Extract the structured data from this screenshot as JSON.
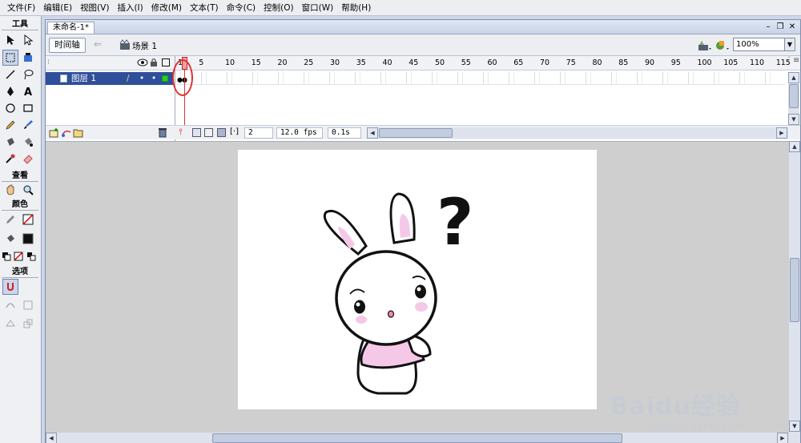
{
  "menu": [
    "文件(F)",
    "编辑(E)",
    "视图(V)",
    "插入(I)",
    "修改(M)",
    "文本(T)",
    "命令(C)",
    "控制(O)",
    "窗口(W)",
    "帮助(H)"
  ],
  "toolbox": {
    "sections": {
      "tools": "工具",
      "view": "查看",
      "colors": "颜色",
      "options": "选项"
    }
  },
  "document": {
    "tab_title": "未命名-1*",
    "timeline_button": "时间轴",
    "scene_label": "场景 1",
    "zoom": "100%"
  },
  "timeline": {
    "layer_name": "图层 1",
    "frame_numbers": [
      "1",
      "5",
      "10",
      "15",
      "20",
      "25",
      "30",
      "35",
      "40",
      "45",
      "50",
      "55",
      "60",
      "65",
      "70",
      "75",
      "80",
      "85",
      "90",
      "95",
      "100",
      "105",
      "110",
      "115"
    ],
    "current_frame": "2",
    "fps": "12.0 fps",
    "time": "0.1s"
  },
  "stage": {
    "question_mark": "?"
  },
  "watermark": {
    "brand": "Baidu经验",
    "url": "jingyan.baidu.com"
  },
  "colors": {
    "selected_layer": "#2f4f9a",
    "playhead": "#e03030",
    "rabbit_pink": "#f6c8e8"
  }
}
